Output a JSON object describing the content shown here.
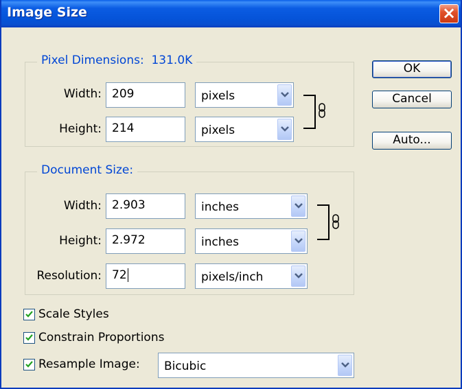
{
  "window": {
    "title": "Image Size",
    "close_glyph": "×"
  },
  "pixel_dimensions": {
    "group_label": "Pixel Dimensions:",
    "size": "131.0K",
    "width_label": "Width:",
    "width_value": "209",
    "width_unit": "pixels",
    "height_label": "Height:",
    "height_value": "214",
    "height_unit": "pixels"
  },
  "document_size": {
    "group_label": "Document Size:",
    "width_label": "Width:",
    "width_value": "2.903",
    "width_unit": "inches",
    "height_label": "Height:",
    "height_value": "2.972",
    "height_unit": "inches",
    "resolution_label": "Resolution:",
    "resolution_value": "72",
    "resolution_unit": "pixels/inch"
  },
  "options": {
    "scale_styles_label": "Scale Styles",
    "scale_styles_checked": true,
    "constrain_label": "Constrain Proportions",
    "constrain_checked": true,
    "resample_label": "Resample Image:",
    "resample_checked": true,
    "resample_method": "Bicubic"
  },
  "buttons": {
    "ok": "OK",
    "cancel": "Cancel",
    "auto": "Auto..."
  },
  "icons": {
    "link": "chain-link-icon",
    "dropdown": "chevron-down-icon",
    "check": "checkmark-icon"
  }
}
